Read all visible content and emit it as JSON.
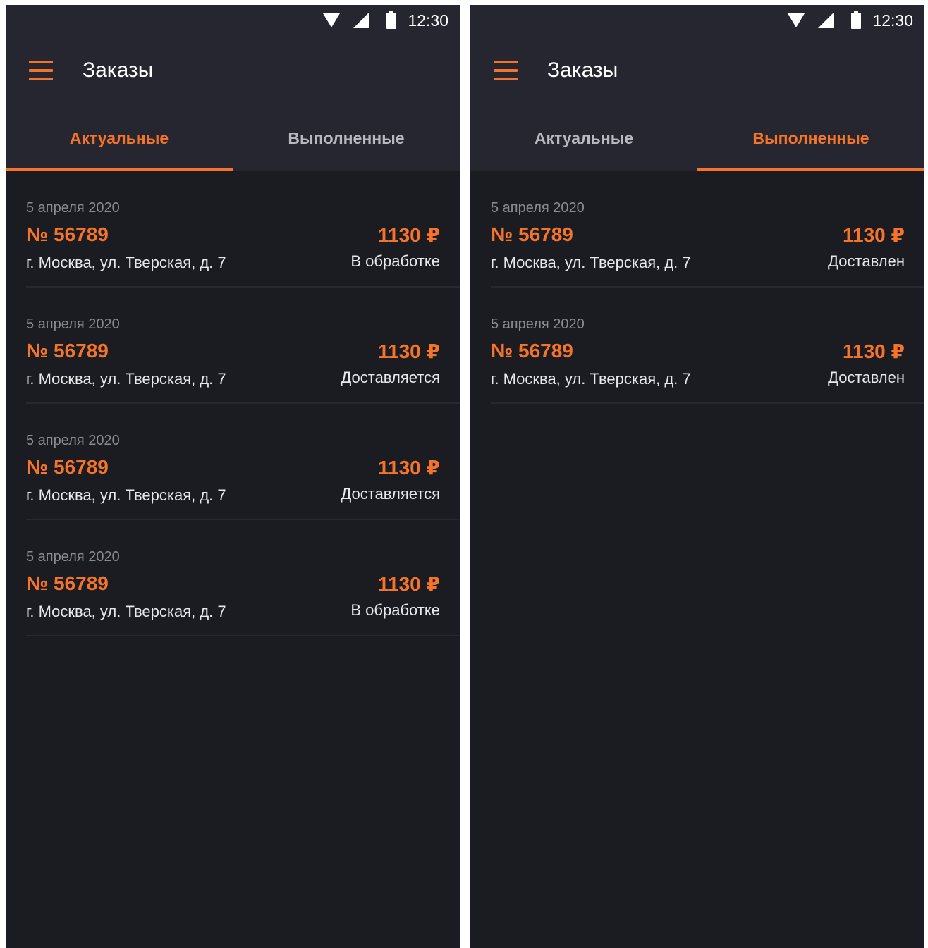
{
  "screens": [
    {
      "status_bar": {
        "time": "12:30",
        "icons": [
          "wifi-icon",
          "signal-icon",
          "battery-icon"
        ]
      },
      "header": {
        "title": "Заказы",
        "menu_icon": "menu-icon"
      },
      "tabs": [
        {
          "label": "Актуальные",
          "active": true
        },
        {
          "label": "Выполненные",
          "active": false
        }
      ],
      "orders": [
        {
          "date": "5 апреля 2020",
          "number": "№ 56789",
          "price": "1130 ₽",
          "address": "г. Москва, ул. Тверская, д. 7",
          "status": "В обработке"
        },
        {
          "date": "5 апреля 2020",
          "number": "№ 56789",
          "price": "1130 ₽",
          "address": "г. Москва, ул. Тверская, д. 7",
          "status": "Доставляется"
        },
        {
          "date": "5 апреля 2020",
          "number": "№ 56789",
          "price": "1130 ₽",
          "address": "г. Москва, ул. Тверская, д. 7",
          "status": "Доставляется"
        },
        {
          "date": "5 апреля 2020",
          "number": "№ 56789",
          "price": "1130 ₽",
          "address": "г. Москва, ул. Тверская, д. 7",
          "status": "В обработке"
        }
      ]
    },
    {
      "status_bar": {
        "time": "12:30",
        "icons": [
          "wifi-icon",
          "signal-icon",
          "battery-icon"
        ]
      },
      "header": {
        "title": "Заказы",
        "menu_icon": "menu-icon"
      },
      "tabs": [
        {
          "label": "Актуальные",
          "active": false
        },
        {
          "label": "Выполненные",
          "active": true
        }
      ],
      "orders": [
        {
          "date": "5 апреля 2020",
          "number": "№ 56789",
          "price": "1130 ₽",
          "address": "г. Москва, ул. Тверская, д. 7",
          "status": "Доставлен"
        },
        {
          "date": "5 апреля 2020",
          "number": "№ 56789",
          "price": "1130 ₽",
          "address": "г. Москва, ул. Тверская, д. 7",
          "status": "Доставлен"
        }
      ]
    }
  ],
  "colors": {
    "accent": "#f5742a",
    "background": "#1b1c22",
    "header": "#262630",
    "text_primary": "#e9e9ec",
    "text_secondary": "#8b8c93",
    "tab_inactive": "#b8b9bf"
  }
}
